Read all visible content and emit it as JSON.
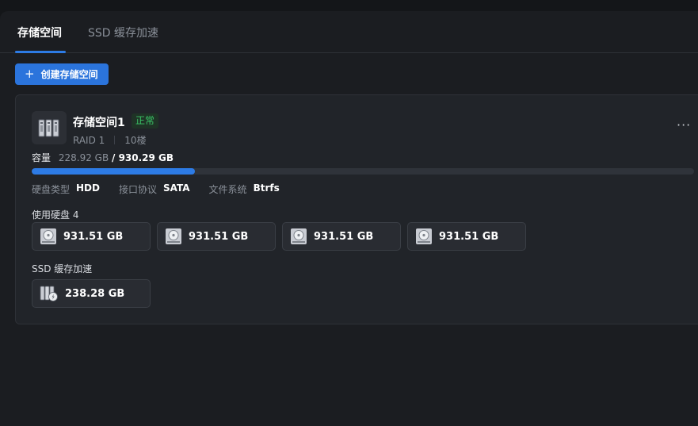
{
  "tabs": [
    {
      "label": "存储空间",
      "active": true
    },
    {
      "label": "SSD 缓存加速",
      "active": false
    }
  ],
  "create_button": {
    "icon": "plus-icon",
    "label": "创建存储空间"
  },
  "pool": {
    "name": "存储空间1",
    "status": "正常",
    "raid": "RAID 1",
    "location": "10楼",
    "capacity_label": "容量",
    "used": "228.92 GB",
    "total": "/ 930.29 GB",
    "usage_fraction": 0.246,
    "props": [
      {
        "key": "硬盘类型",
        "value": "HDD"
      },
      {
        "key": "接口协议",
        "value": "SATA"
      },
      {
        "key": "文件系统",
        "value": "Btrfs"
      }
    ],
    "disks_label": "使用硬盘 4",
    "disks": [
      "931.51 GB",
      "931.51 GB",
      "931.51 GB",
      "931.51 GB"
    ],
    "cache_label": "SSD 缓存加速",
    "cache_disks": [
      "238.28 GB"
    ],
    "more_icon": "more-horizontal-icon"
  },
  "colors": {
    "accent": "#2d7be5",
    "status_ok": "#3ac467",
    "background": "#1b1d21",
    "card": "#212429"
  }
}
